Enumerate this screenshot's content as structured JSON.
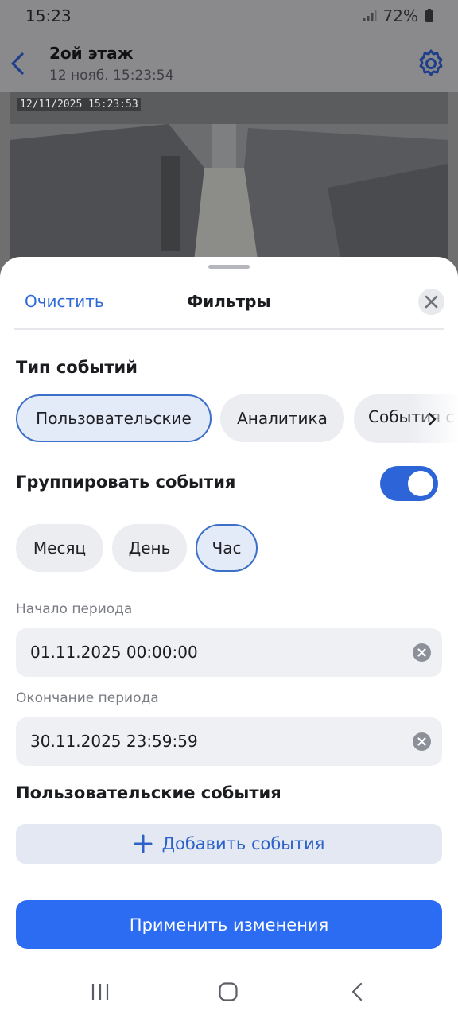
{
  "status": {
    "time": "15:23",
    "battery": "72%"
  },
  "camera": {
    "title": "2ой этаж",
    "subtitle": "12 нояб. 15:23:54",
    "overlay_timestamp": "12/11/2025 15:23:53"
  },
  "sheet": {
    "clear_label": "Очистить",
    "title": "Фильтры"
  },
  "event_type": {
    "title": "Тип событий",
    "chips": [
      {
        "label": "Пользовательские",
        "selected": true
      },
      {
        "label": "Аналитика",
        "selected": false
      },
      {
        "label": "События с",
        "selected": false
      }
    ]
  },
  "grouping": {
    "title": "Группировать события",
    "enabled": true,
    "options": [
      {
        "label": "Месяц",
        "selected": false
      },
      {
        "label": "День",
        "selected": false
      },
      {
        "label": "Час",
        "selected": true
      }
    ]
  },
  "period": {
    "start_label": "Начало периода",
    "start_value": "01.11.2025 00:00:00",
    "end_label": "Окончание периода",
    "end_value": "30.11.2025 23:59:59"
  },
  "user_events": {
    "title": "Пользовательские события",
    "add_label": "Добавить события"
  },
  "apply_label": "Применить изменения",
  "colors": {
    "accent": "#2b6cf3",
    "link": "#2e6bd9",
    "chip_bg": "#ecedf1",
    "selected_border": "#3b6fc8"
  },
  "icons": [
    "back-icon",
    "gear-icon",
    "close-icon",
    "chevron-right-icon",
    "clear-icon",
    "plus-icon",
    "nav-recents-icon",
    "nav-home-icon",
    "nav-back-icon"
  ]
}
